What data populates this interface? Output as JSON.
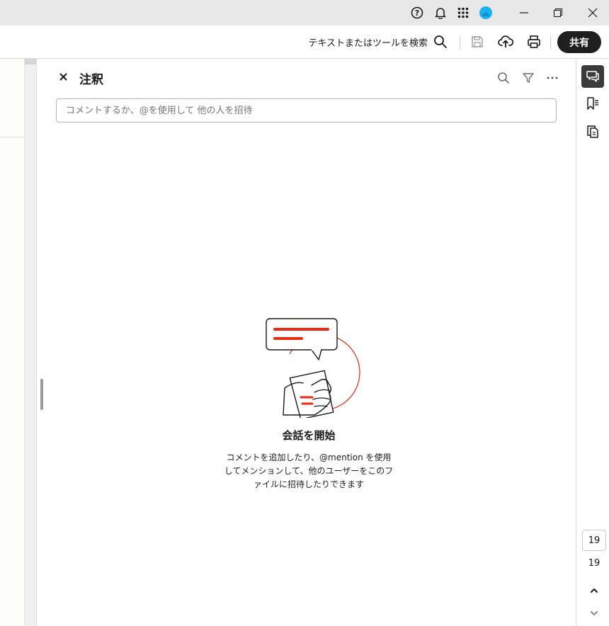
{
  "titlebar": {
    "icons": [
      "help-icon",
      "bell-icon",
      "apps-grid-icon",
      "user-avatar"
    ],
    "window_controls": [
      "minimize",
      "restore",
      "close"
    ]
  },
  "toolbar": {
    "search_label": "テキストまたはツールを検索",
    "icons": [
      "search-icon",
      "save-icon",
      "upload-cloud-icon",
      "print-icon"
    ],
    "share_label": "共有"
  },
  "comments_panel": {
    "title": "注釈",
    "header_icons": [
      "search-icon",
      "filter-icon",
      "more-icon"
    ],
    "input_placeholder": "コメントするか、@を使用して 他の人を招待",
    "empty_state": {
      "title": "会話を開始",
      "description": "コメントを追加したり、@mention を使用してメンションして、他のユーザーをこのファイルに招待したりできます"
    }
  },
  "right_rail": {
    "icons": [
      "comment-icon",
      "bookmark-icon",
      "pages-icon"
    ],
    "current_page": "19",
    "total_pages": "19"
  },
  "colors": {
    "accent_red": "#eb2a0f",
    "share_button": "#1f1f1f",
    "active_rail": "#3b3b3b"
  }
}
